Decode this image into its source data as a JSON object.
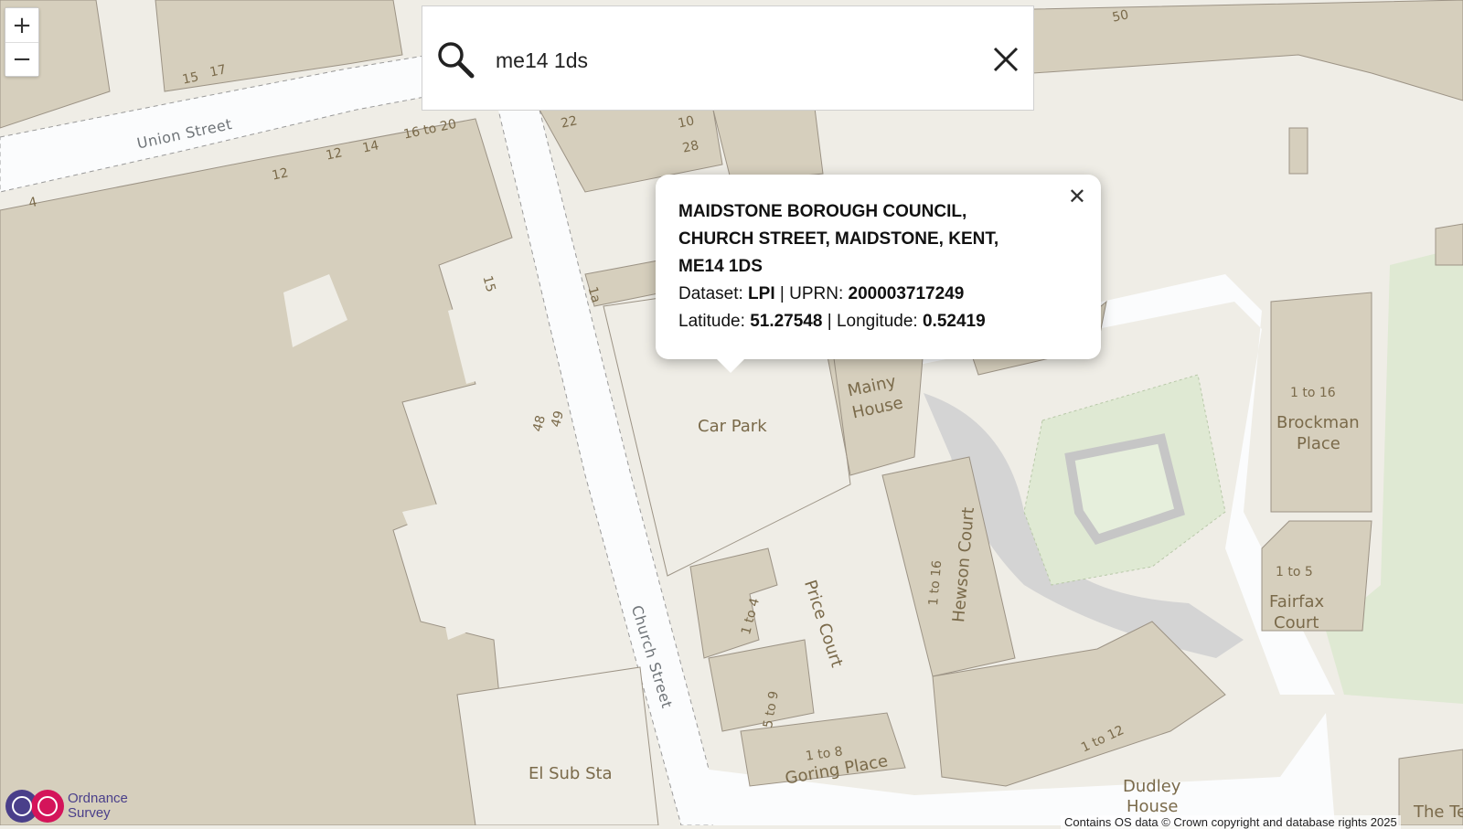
{
  "map": {
    "zoom_in": "+",
    "zoom_out": "−",
    "labels": {
      "union_street": "Union Street",
      "church_street": "Church Street",
      "car_park": "Car Park",
      "mainy_house_1": "Mainy",
      "mainy_house_2": "House",
      "brockman_1": "1 to 16",
      "brockman_2": "Brockman",
      "brockman_3": "Place",
      "fairfax_1": "1 to 5",
      "fairfax_2": "Fairfax",
      "fairfax_3": "Court",
      "hewson_court": "Hewson Court",
      "hewson_range": "1 to 16",
      "price_court": "Price Court",
      "goring_range": "1 to 8",
      "goring_place": "Goring Place",
      "range_1to12": "1 to 12",
      "dudley_1": "Dudley",
      "dudley_2": "House",
      "el_sub_sta": "El Sub Sta",
      "range_1to4": "1 to 4",
      "range_5to9": "5 to 9",
      "n15": "15",
      "n17": "17",
      "n16to20": "16 to 20",
      "n14": "14",
      "n12a": "12",
      "n12b": "12",
      "n4": "4",
      "n22": "22",
      "n10": "10",
      "n28": "28",
      "n50": "50",
      "n48": "48",
      "n49": "49",
      "n1a": "1a",
      "n15b": "15",
      "the_t": "The Te"
    }
  },
  "search": {
    "value": "me14 1ds",
    "placeholder": ""
  },
  "popup": {
    "address": "MAIDSTONE BOROUGH COUNCIL, CHURCH STREET, MAIDSTONE, KENT, ME14 1DS",
    "dataset_label": "Dataset:",
    "dataset_value": "LPI",
    "uprn_label": "UPRN:",
    "uprn_value": "200003717249",
    "latitude_label": "Latitude:",
    "latitude_value": "51.27548",
    "longitude_label": "Longitude:",
    "longitude_value": "0.52419",
    "separator": "|",
    "close": "✕"
  },
  "logo": {
    "line1": "Ordnance",
    "line2": "Survey"
  },
  "attribution": "Contains OS data © Crown copyright and database rights 2025",
  "colors": {
    "building": "#d6cfbd",
    "road": "#fbfcfd",
    "ground": "#efede6",
    "green": "#dfe9d3",
    "path": "#c9c9c9"
  }
}
